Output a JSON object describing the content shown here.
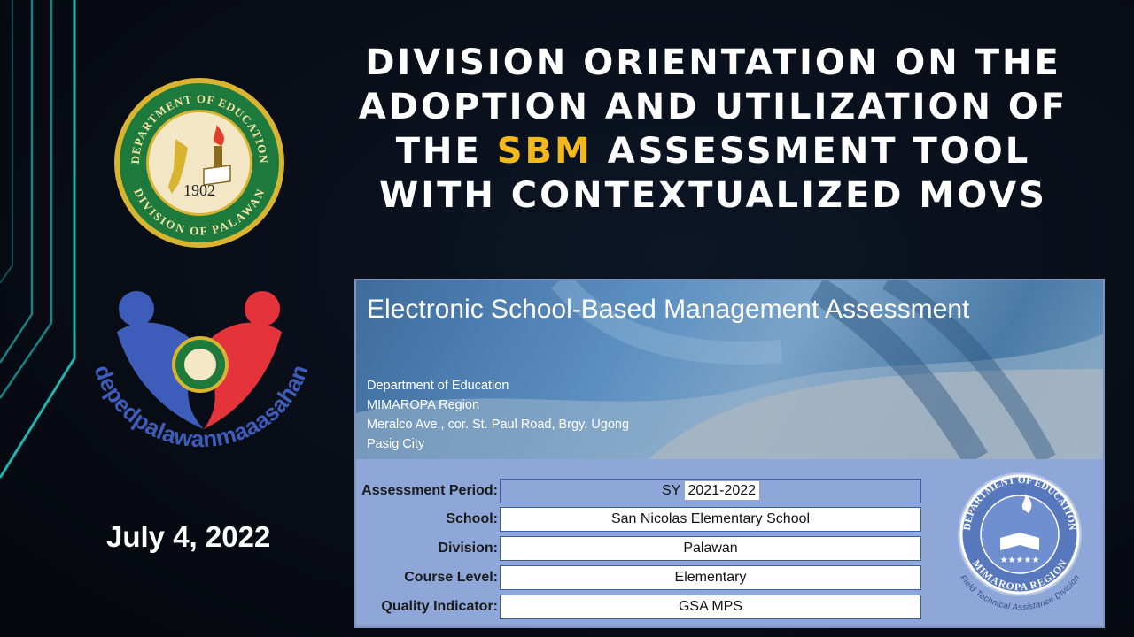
{
  "title": {
    "before": "DIVISION ORIENTATION ON THE ADOPTION AND UTILIZATION OF THE",
    "highlight": "SBM",
    "after": "ASSESSMENT TOOL WITH CONTEXTUALIZED MOVS",
    "highlight_color": "#f2b81c"
  },
  "date": "July 4, 2022",
  "deped_seal": {
    "text_top": "DEPARTMENT OF EDUCATION",
    "text_bottom": "DIVISION OF PALAWAN",
    "year": "1902"
  },
  "campaign_logo": {
    "text": "depedpalawanmaaasahan"
  },
  "esbm": {
    "title": "Electronic School-Based Management Assessment",
    "address": [
      "Department of Education",
      "MIMAROPA Region",
      "Meralco Ave., cor. St. Paul Road, Brgy. Ugong",
      "Pasig City"
    ],
    "form": {
      "period_label": "Assessment Period:",
      "period_prefix": "SY",
      "period_value": "2021-2022",
      "school_label": "School:",
      "school_value": "San Nicolas Elementary School",
      "division_label": "Division:",
      "division_value": "Palawan",
      "course_label": "Course Level:",
      "course_value": "Elementary",
      "quality_label": "Quality Indicator:",
      "quality_value": "GSA MPS"
    },
    "region_seal": {
      "text_top": "DEPARTMENT OF EDUCATION",
      "text_bottom": "MIMAROPA REGION",
      "text_side": "Field Technical Assistance Division"
    }
  }
}
